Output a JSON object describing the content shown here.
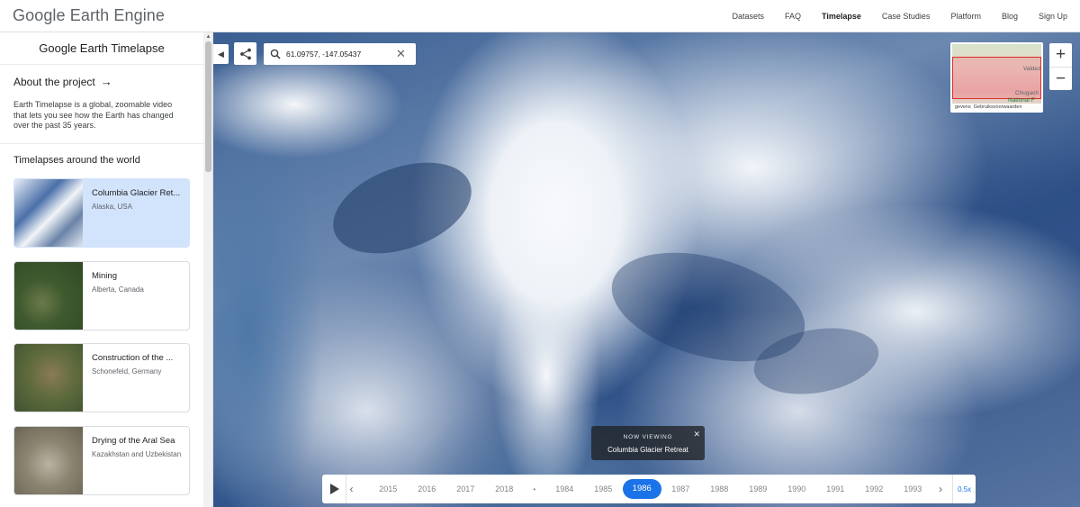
{
  "header": {
    "logo": "Google Earth Engine",
    "nav": [
      "Datasets",
      "FAQ",
      "Timelapse",
      "Case Studies",
      "Platform",
      "Blog",
      "Sign Up"
    ],
    "active_nav": "Timelapse"
  },
  "sidebar": {
    "title": "Google Earth Timelapse",
    "about_label": "About the project",
    "about_desc": "Earth Timelapse is a global, zoomable video that lets you see how the Earth has changed over the past 35 years.",
    "section_title": "Timelapses around the world",
    "cards": [
      {
        "title": "Columbia Glacier Ret...",
        "subtitle": "Alaska, USA",
        "thumb_icon": "glacier-thumbnail"
      },
      {
        "title": "Mining",
        "subtitle": "Alberta, Canada",
        "thumb_icon": "mining-thumbnail"
      },
      {
        "title": "Construction of the ...",
        "subtitle": "Schonefeld, Germany",
        "thumb_icon": "construction-thumbnail"
      },
      {
        "title": "Drying of the Aral Sea",
        "subtitle": "Kazakhstan and Uzbekistan",
        "thumb_icon": "aral-sea-thumbnail"
      }
    ]
  },
  "map": {
    "search_value": "61.09757, -147.05437",
    "minimap": {
      "labels": [
        "Valdez",
        "Chugach",
        "National F"
      ],
      "footer": [
        "gevens",
        "Gebruiksvoorwaarden"
      ]
    },
    "now_viewing": {
      "label": "NOW VIEWING",
      "title": "Columbia Glacier Retreat"
    },
    "timeline": {
      "years": [
        "2015",
        "2016",
        "2017",
        "2018",
        "•",
        "1984",
        "1985",
        "1986",
        "1987",
        "1988",
        "1989",
        "1990",
        "1991",
        "1992",
        "1993"
      ],
      "active_year": "1986",
      "speed": "0.5x"
    }
  },
  "colors": {
    "accent": "#1a73e8",
    "active_card": "#d2e3fc"
  }
}
